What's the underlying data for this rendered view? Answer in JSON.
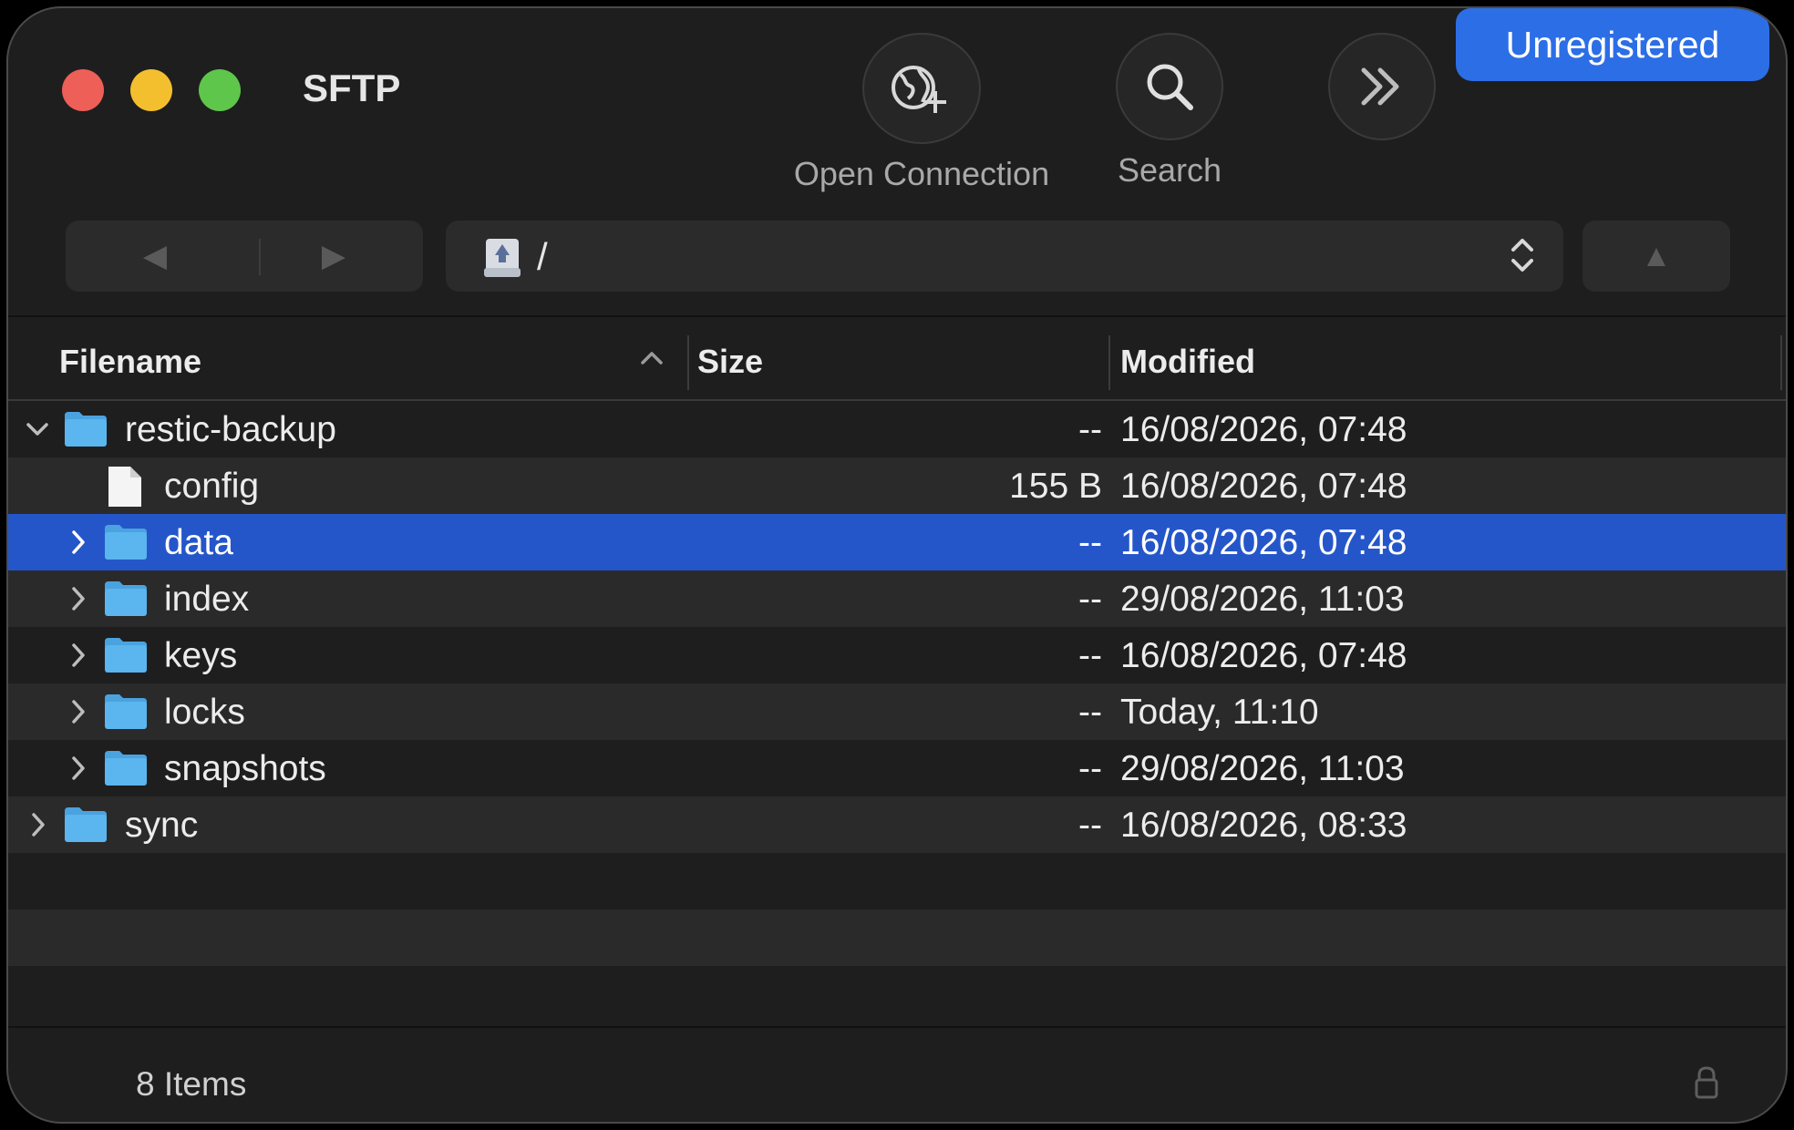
{
  "window": {
    "title": "SFTP",
    "badge": "Unregistered"
  },
  "toolbar": {
    "open_connection_label": "Open Connection",
    "search_label": "Search"
  },
  "path": {
    "value": "/"
  },
  "table": {
    "columns": {
      "filename": "Filename",
      "size": "Size",
      "modified": "Modified"
    },
    "rows": [
      {
        "name": "restic-backup",
        "type": "folder",
        "expanded": true,
        "depth": 0,
        "size": "--",
        "modified": "16/08/2026, 07:48",
        "selected": false
      },
      {
        "name": "config",
        "type": "file",
        "expanded": false,
        "depth": 1,
        "size": "155 B",
        "modified": "16/08/2026, 07:48",
        "selected": false
      },
      {
        "name": "data",
        "type": "folder",
        "expanded": false,
        "depth": 1,
        "size": "--",
        "modified": "16/08/2026, 07:48",
        "selected": true
      },
      {
        "name": "index",
        "type": "folder",
        "expanded": false,
        "depth": 1,
        "size": "--",
        "modified": "29/08/2026, 11:03",
        "selected": false
      },
      {
        "name": "keys",
        "type": "folder",
        "expanded": false,
        "depth": 1,
        "size": "--",
        "modified": "16/08/2026, 07:48",
        "selected": false
      },
      {
        "name": "locks",
        "type": "folder",
        "expanded": false,
        "depth": 1,
        "size": "--",
        "modified": "Today, 11:10",
        "selected": false
      },
      {
        "name": "snapshots",
        "type": "folder",
        "expanded": false,
        "depth": 1,
        "size": "--",
        "modified": "29/08/2026, 11:03",
        "selected": false
      },
      {
        "name": "sync",
        "type": "folder",
        "expanded": false,
        "depth": 0,
        "size": "--",
        "modified": "16/08/2026, 08:33",
        "selected": false
      }
    ]
  },
  "status": {
    "items_label": "8 Items"
  },
  "colors": {
    "accent": "#2c6ee6",
    "selection": "#2556c9",
    "folder": "#5bb5ee"
  }
}
